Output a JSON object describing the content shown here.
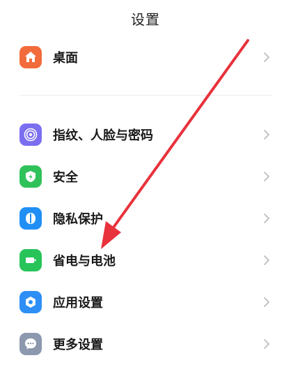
{
  "header": {
    "title": "设置"
  },
  "items": [
    {
      "label": "桌面",
      "icon": "home-icon",
      "color": "#f26c3b"
    },
    {
      "label": "指纹、人脸与密码",
      "icon": "fingerprint-icon",
      "color": "#7b6ef0"
    },
    {
      "label": "安全",
      "icon": "shield-icon",
      "color": "#2fc25a"
    },
    {
      "label": "隐私保护",
      "icon": "privacy-icon",
      "color": "#1f8ff5"
    },
    {
      "label": "省电与电池",
      "icon": "battery-icon",
      "color": "#28c45a"
    },
    {
      "label": "应用设置",
      "icon": "app-settings-icon",
      "color": "#2d8ff5"
    },
    {
      "label": "更多设置",
      "icon": "more-icon",
      "color": "#8b98ad"
    }
  ],
  "annotation": {
    "arrow_color": "#e8323c"
  }
}
